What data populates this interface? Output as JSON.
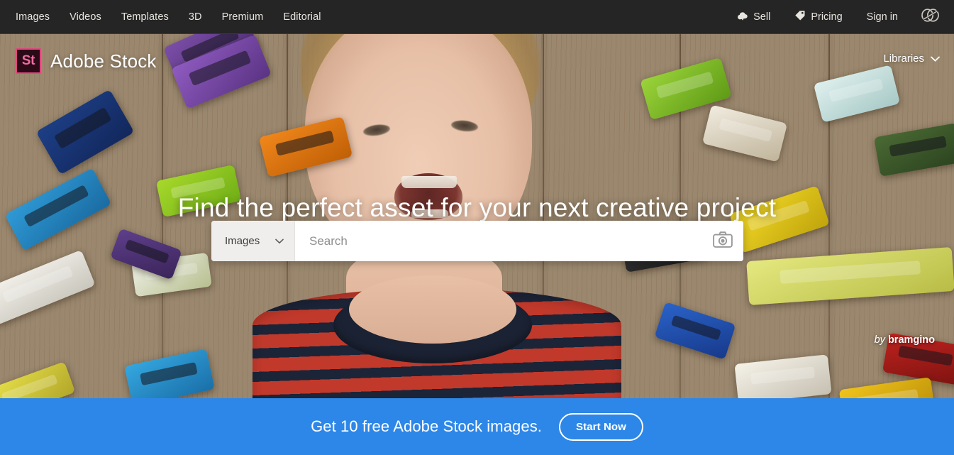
{
  "topbar": {
    "nav_links": [
      {
        "label": "Images"
      },
      {
        "label": "Videos"
      },
      {
        "label": "Templates"
      },
      {
        "label": "3D"
      },
      {
        "label": "Premium"
      },
      {
        "label": "Editorial"
      }
    ],
    "sell": {
      "label": "Sell",
      "icon": "cloud-upload-icon"
    },
    "pricing": {
      "label": "Pricing",
      "icon": "price-tag-icon"
    },
    "signin": {
      "label": "Sign in"
    },
    "creative_cloud": {
      "icon": "creative-cloud-icon"
    }
  },
  "hero": {
    "logo": {
      "mark": "St",
      "text": "Adobe Stock"
    },
    "libraries": {
      "label": "Libraries",
      "icon": "chevron-down-icon"
    },
    "headline": "Find the perfect asset for your next creative project",
    "attribution": {
      "by": "by",
      "author": "bramgino"
    }
  },
  "search": {
    "type_selected": "Images",
    "type_icon": "chevron-down-icon",
    "placeholder": "Search",
    "value": "",
    "camera_icon": "camera-icon"
  },
  "promo": {
    "text": "Get 10 free Adobe Stock images.",
    "button_label": "Start Now"
  },
  "colors": {
    "topbar_bg": "#252525",
    "promo_blue": "#2d87e8",
    "logo_pink": "#e1467c",
    "text_light": "#e8e4de"
  }
}
